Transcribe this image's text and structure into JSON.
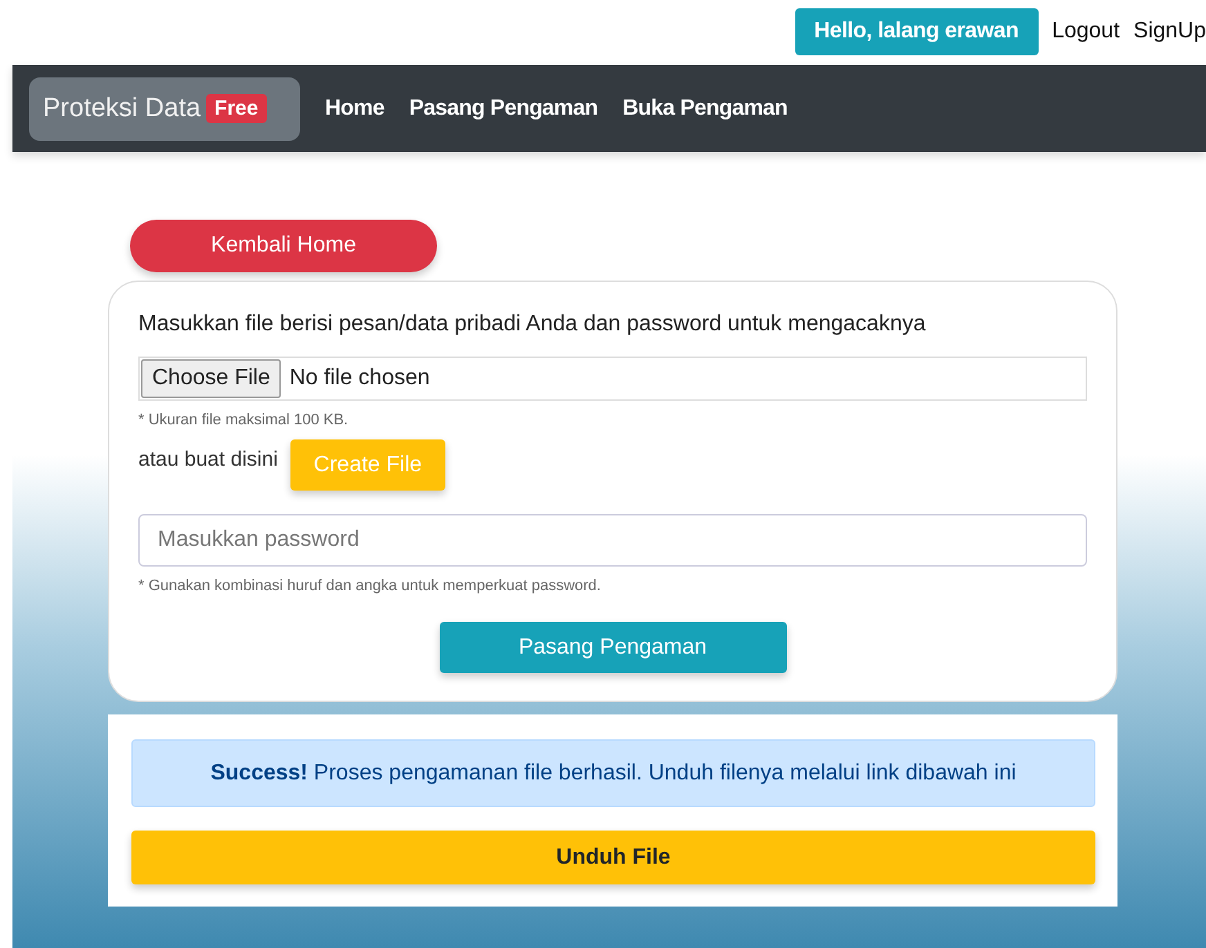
{
  "user_bar": {
    "greeting": "Hello, lalang erawan",
    "links": [
      "Logout",
      "SignUp"
    ]
  },
  "navbar": {
    "brand": "Proteksi Data",
    "badge": "Free",
    "links": [
      {
        "label": "Home"
      },
      {
        "label": "Pasang Pengaman"
      },
      {
        "label": "Buka Pengaman"
      }
    ]
  },
  "back_button": "Kembali Home",
  "form": {
    "heading": "Masukkan file berisi pesan/data pribadi Anda dan password untuk mengacaknya",
    "file_input": {
      "button": "Choose File",
      "status": "No file chosen"
    },
    "file_hint": "* Ukuran file maksimal 100 KB.",
    "create_label": "atau buat disini",
    "create_button": "Create File",
    "password": {
      "placeholder": "Masukkan password"
    },
    "password_hint": "* Gunakan kombinasi huruf dan angka untuk memperkuat password.",
    "submit": "Pasang Pengaman"
  },
  "result": {
    "alert": "**Success!** Proses pengamanan file berhasil. Unduh filenya melalui link dibawah ini",
    "download": "Unduh File"
  }
}
